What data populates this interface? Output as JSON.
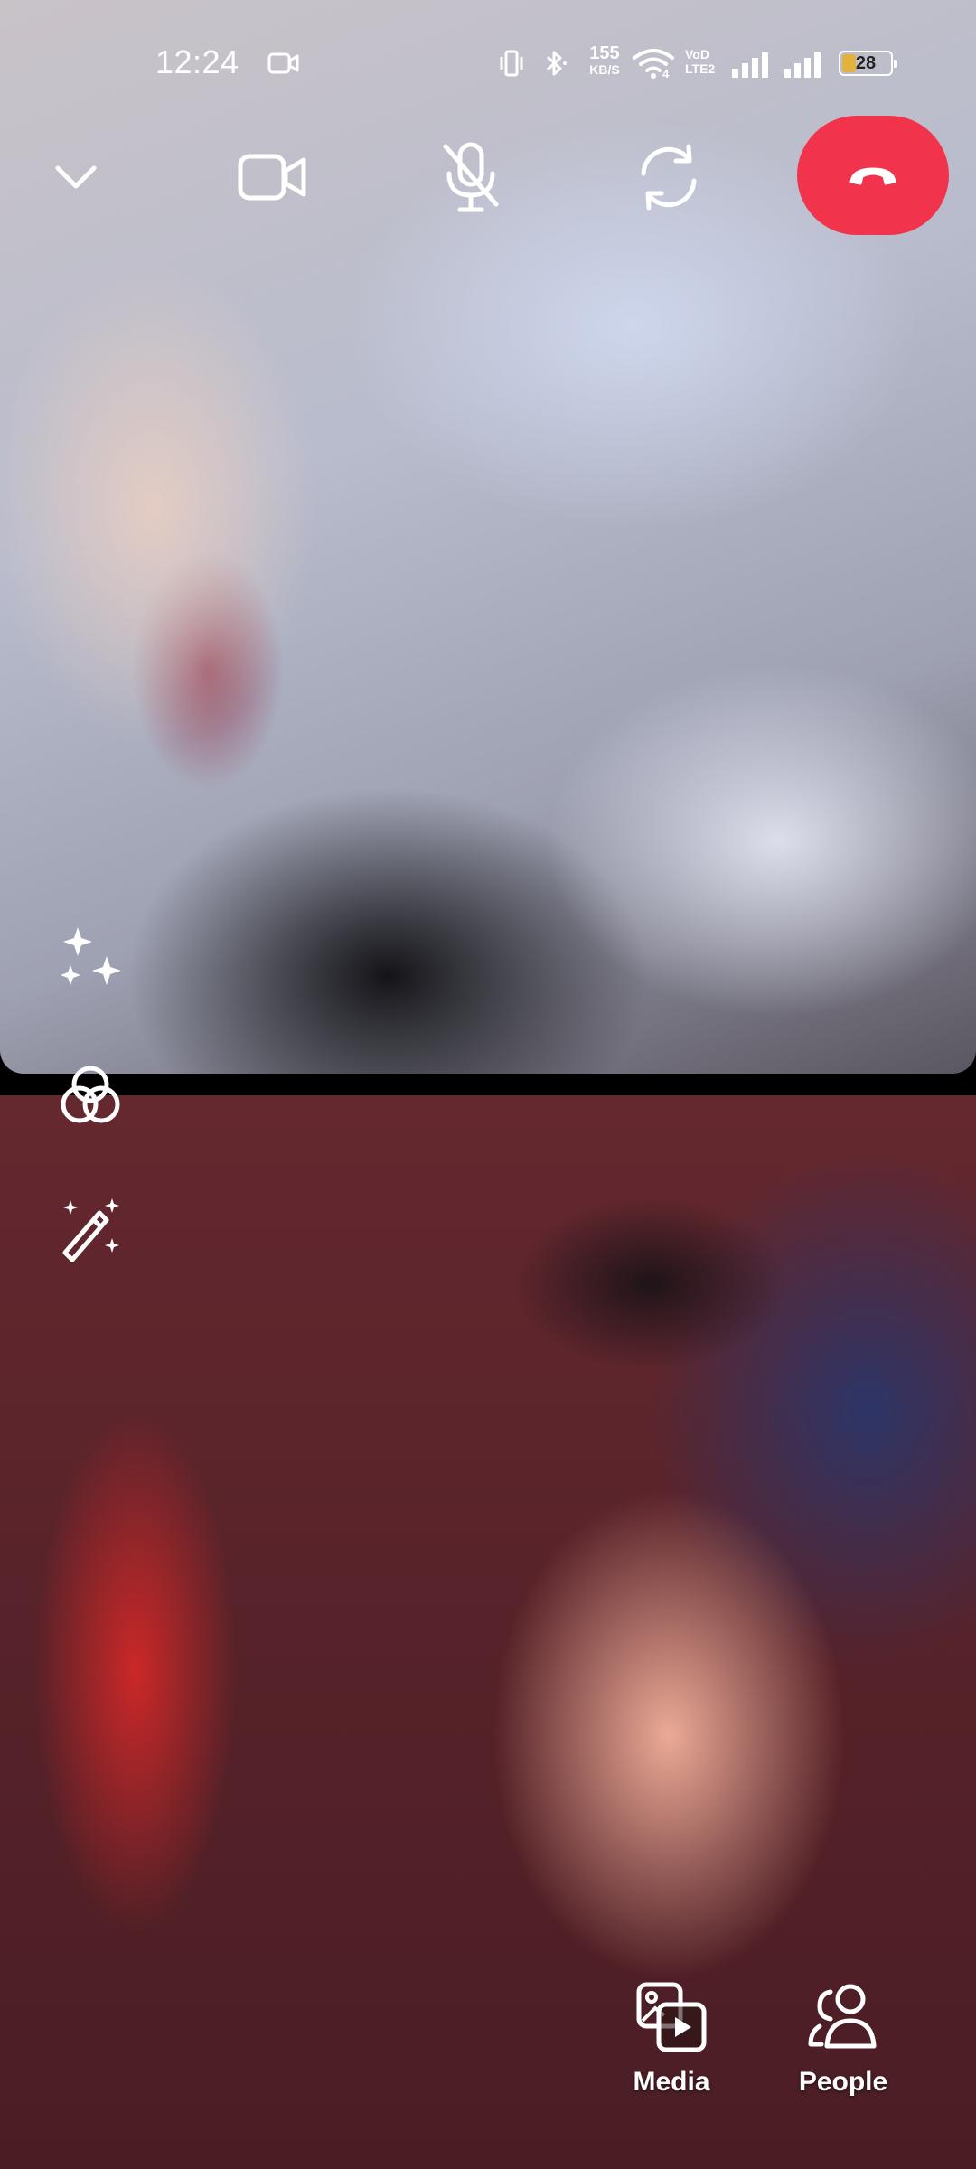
{
  "status_bar": {
    "time": "12:24",
    "net_speed_value": "155",
    "net_speed_unit": "KB/S",
    "volte_line1": "VoD",
    "volte_line2": "LTE2",
    "wifi_badge": "4",
    "battery_level": "28",
    "battery_fraction": 0.28,
    "icons": [
      "video-camera-icon",
      "vibrate-icon",
      "bluetooth-icon",
      "wifi-icon",
      "signal-icon",
      "signal-icon",
      "battery-icon"
    ]
  },
  "call_controls": {
    "icons": [
      "chevron-down-icon",
      "video-camera-icon",
      "mic-off-icon",
      "switch-camera-icon",
      "end-call-icon"
    ],
    "end_call_color": "#f1344b"
  },
  "side_tools": {
    "icons": [
      "sparkles-icon",
      "filters-icon",
      "magic-wand-icon"
    ]
  },
  "bottom_actions": {
    "media_label": "Media",
    "people_label": "People"
  },
  "feeds": {
    "top": "remote-participant-video",
    "bottom": "local-participant-video"
  }
}
